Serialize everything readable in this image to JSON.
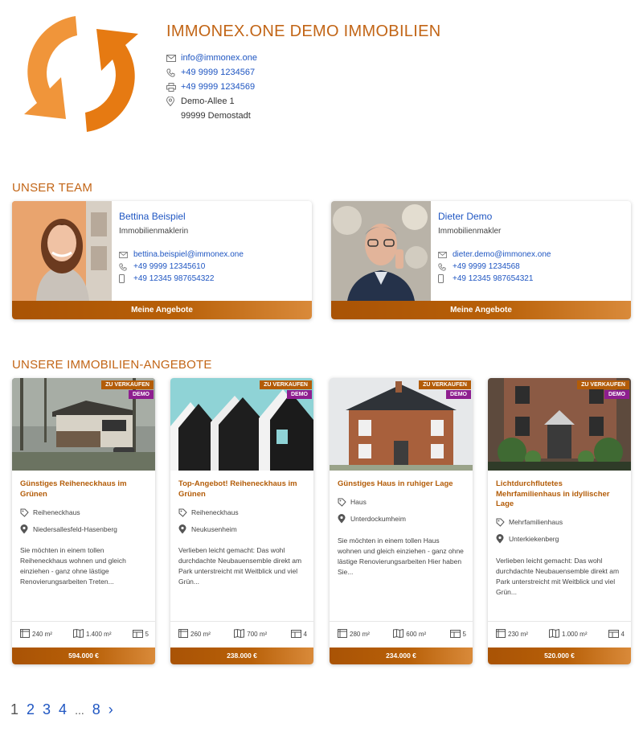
{
  "company": {
    "name": "IMMONEX.ONE DEMO IMMOBILIEN",
    "email": "info@immonex.one",
    "phone": "+49 9999 1234567",
    "fax": "+49 9999 1234569",
    "address_line1": "Demo-Allee 1",
    "address_line2": "99999 Demostadt"
  },
  "team": {
    "heading": "UNSER TEAM",
    "members": [
      {
        "name": "Bettina Beispiel",
        "role": "Immobilienmaklerin",
        "email": "bettina.beispiel@immonex.one",
        "phone": "+49 9999 12345610",
        "mobile": "+49 12345 987654322",
        "button": "Meine Angebote"
      },
      {
        "name": "Dieter Demo",
        "role": "Immobilienmakler",
        "email": "dieter.demo@immonex.one",
        "phone": "+49 9999 1234568",
        "mobile": "+49 12345 987654321",
        "button": "Meine Angebote"
      }
    ]
  },
  "listings": {
    "heading": "UNSERE IMMOBILIEN-ANGEBOTE",
    "badge_sale": "ZU VERKAUFEN",
    "badge_demo": "DEMO",
    "items": [
      {
        "title": "Günstiges Reiheneckhaus im Grünen",
        "type": "Reiheneckhaus",
        "location": "Niedersallesfeld-Hasenberg",
        "description": "Sie möchten in einem tollen Reiheneckhaus wohnen und gleich einziehen - ganz ohne lästige Renovierungsarbeiten Treten...",
        "living_area": "240 m²",
        "plot_area": "1.400 m²",
        "rooms": "5",
        "price": "594.000 €"
      },
      {
        "title": "Top-Angebot! Reiheneckhaus im Grünen",
        "type": "Reiheneckhaus",
        "location": "Neukusenheim",
        "description": "Verlieben leicht gemacht: Das wohl durchdachte Neubauensemble direkt am Park unterstreicht mit Weitblick und viel Grün...",
        "living_area": "260 m²",
        "plot_area": "700 m²",
        "rooms": "4",
        "price": "238.000 €"
      },
      {
        "title": "Günstiges Haus in ruhiger Lage",
        "type": "Haus",
        "location": "Unterdockumheim",
        "description": "Sie möchten in einem tollen Haus wohnen und gleich einziehen - ganz ohne lästige Renovierungsarbeiten Hier haben Sie...",
        "living_area": "280 m²",
        "plot_area": "600 m²",
        "rooms": "5",
        "price": "234.000 €"
      },
      {
        "title": "Lichtdurchflutetes Mehrfamilienhaus in idyllischer Lage",
        "type": "Mehrfamilienhaus",
        "location": "Unterkiekenberg",
        "description": "Verlieben leicht gemacht: Das wohl durchdachte Neubauensemble direkt am Park unterstreicht mit Weitblick und viel Grün...",
        "living_area": "230 m²",
        "plot_area": "1.000 m²",
        "rooms": "4",
        "price": "520.000 €"
      }
    ]
  },
  "pagination": {
    "current": "1",
    "pages": [
      "2",
      "3",
      "4"
    ],
    "ellipsis": "...",
    "last": "8",
    "next": "›"
  },
  "colors": {
    "accent": "#c26516",
    "link": "#1f56c2",
    "badge_sale": "#b35c08",
    "badge_demo": "#8e1e8f"
  }
}
